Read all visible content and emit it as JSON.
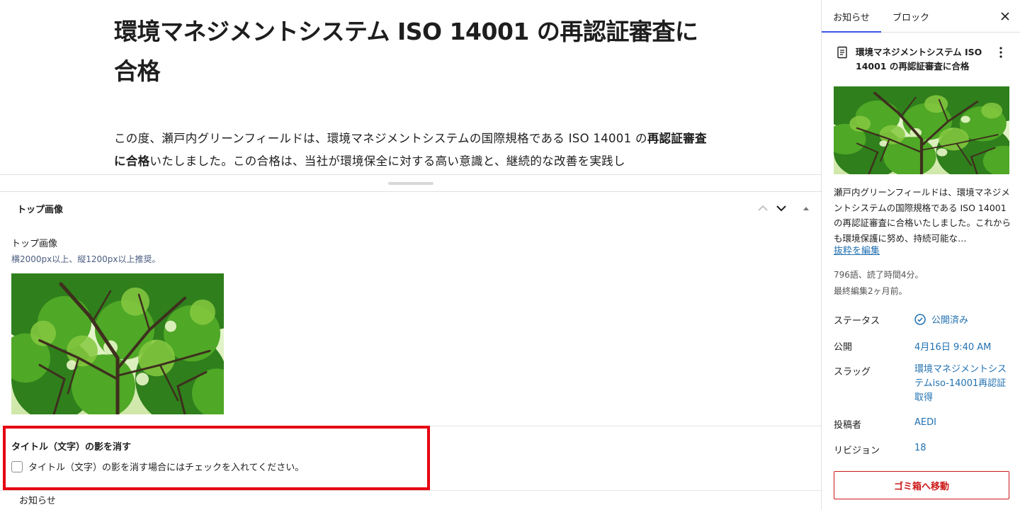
{
  "post": {
    "title": "環境マネジメントシステム ISO 14001 の再認証審査に合格",
    "paragraph_a": "この度、瀬戸内グリーンフィールドは、環境マネジメントシステムの国際規格である ISO 14001 の",
    "paragraph_bold": "再認証審査に合格",
    "paragraph_b": "いたしました。この合格は、当社が環境保全に対する高い意識と、継続的な改善を実践し"
  },
  "metabox": {
    "title": "トップ画像",
    "field_label": "トップ画像",
    "field_desc": "横2000px以上、縦1200px以上推奨。",
    "shadow_label": "タイトル（文字）の影を消す",
    "shadow_checkbox_label": "タイトル（文字）の影を消す場合にはチェックを入れてください。",
    "shadow_checked": false
  },
  "breadcrumb": "お知らせ",
  "sidebar": {
    "tab_post": "お知らせ",
    "tab_block": "ブロック",
    "doc_title": "環境マネジメントシステム ISO 14001 の再認証審査に合格",
    "excerpt": "瀬戸内グリーンフィールドは、環境マネジメントシステムの国際規格である ISO 14001 の再認証審査に合格いたしました。これからも環境保護に努め、持続可能な…",
    "edit_excerpt": "抜粋を編集",
    "stats_words": "796語、読了時間4分。",
    "stats_edited": "最終編集2ヶ月前。",
    "rows": {
      "status_label": "ステータス",
      "status_value": "公開済み",
      "publish_label": "公開",
      "publish_value": "4月16日 9:40 AM",
      "slug_label": "スラッグ",
      "slug_value": "環境マネジメントシステムiso-14001再認証取得",
      "author_label": "投稿者",
      "author_value": "AEDI",
      "revision_label": "リビジョン",
      "revision_value": "18"
    },
    "trash_button": "ゴミ箱へ移動"
  },
  "colors": {
    "accent": "#3858e9",
    "link": "#2271b1",
    "highlight": "#e60012",
    "danger": "#cc1818"
  },
  "icons": [
    "chevron-up-icon",
    "chevron-down-icon",
    "caret-up-icon",
    "close-icon",
    "document-icon",
    "more-vertical-icon",
    "published-check-icon",
    "tree-image"
  ]
}
